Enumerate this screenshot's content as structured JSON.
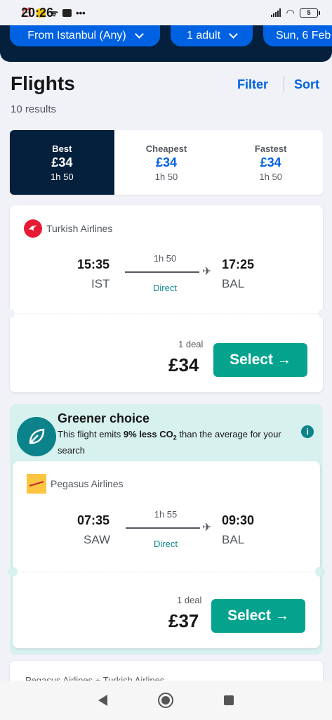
{
  "status": {
    "time": "20:26",
    "battery": "5"
  },
  "search": {
    "origin": "From Istanbul (Any)",
    "passengers": "1 adult",
    "date": "Sun, 6 Feb"
  },
  "header": {
    "title": "Flights",
    "results": "10 results",
    "filter": "Filter",
    "sort": "Sort"
  },
  "tabs": [
    {
      "label": "Best",
      "price": "£34",
      "duration": "1h 50"
    },
    {
      "label": "Cheapest",
      "price": "£34",
      "duration": "1h 50"
    },
    {
      "label": "Fastest",
      "price": "£34",
      "duration": "1h 50"
    }
  ],
  "flights": [
    {
      "airline": "Turkish Airlines",
      "depart_time": "15:35",
      "depart_code": "IST",
      "duration": "1h 50",
      "stops": "Direct",
      "arrive_time": "17:25",
      "arrive_code": "BAL",
      "deals": "1 deal",
      "price": "£34",
      "select": "Select"
    },
    {
      "airline": "Pegasus Airlines",
      "depart_time": "07:35",
      "depart_code": "SAW",
      "duration": "1h 55",
      "stops": "Direct",
      "arrive_time": "09:30",
      "arrive_code": "BAL",
      "deals": "1 deal",
      "price": "£37",
      "select": "Select"
    }
  ],
  "greener": {
    "title": "Greener choice",
    "text_pre": "This flight emits ",
    "text_bold": "9% less CO",
    "text_sub": "2",
    "text_post": " than the average for your search"
  },
  "peek": {
    "airline": "Pegasus Airlines + Turkish Airlines"
  },
  "colors": {
    "brand": "#0062e3",
    "navy": "#05203c",
    "select": "#05a38e",
    "eco": "#0c838a"
  },
  "icons": [
    "alarm-icon",
    "notification-icon",
    "wifi-icon",
    "message-icon",
    "signal-icon",
    "battery-icon",
    "chevron-down-icon",
    "plane-icon",
    "arrow-right-icon",
    "leaf-icon",
    "info-icon",
    "back-icon",
    "home-icon",
    "recents-icon"
  ]
}
